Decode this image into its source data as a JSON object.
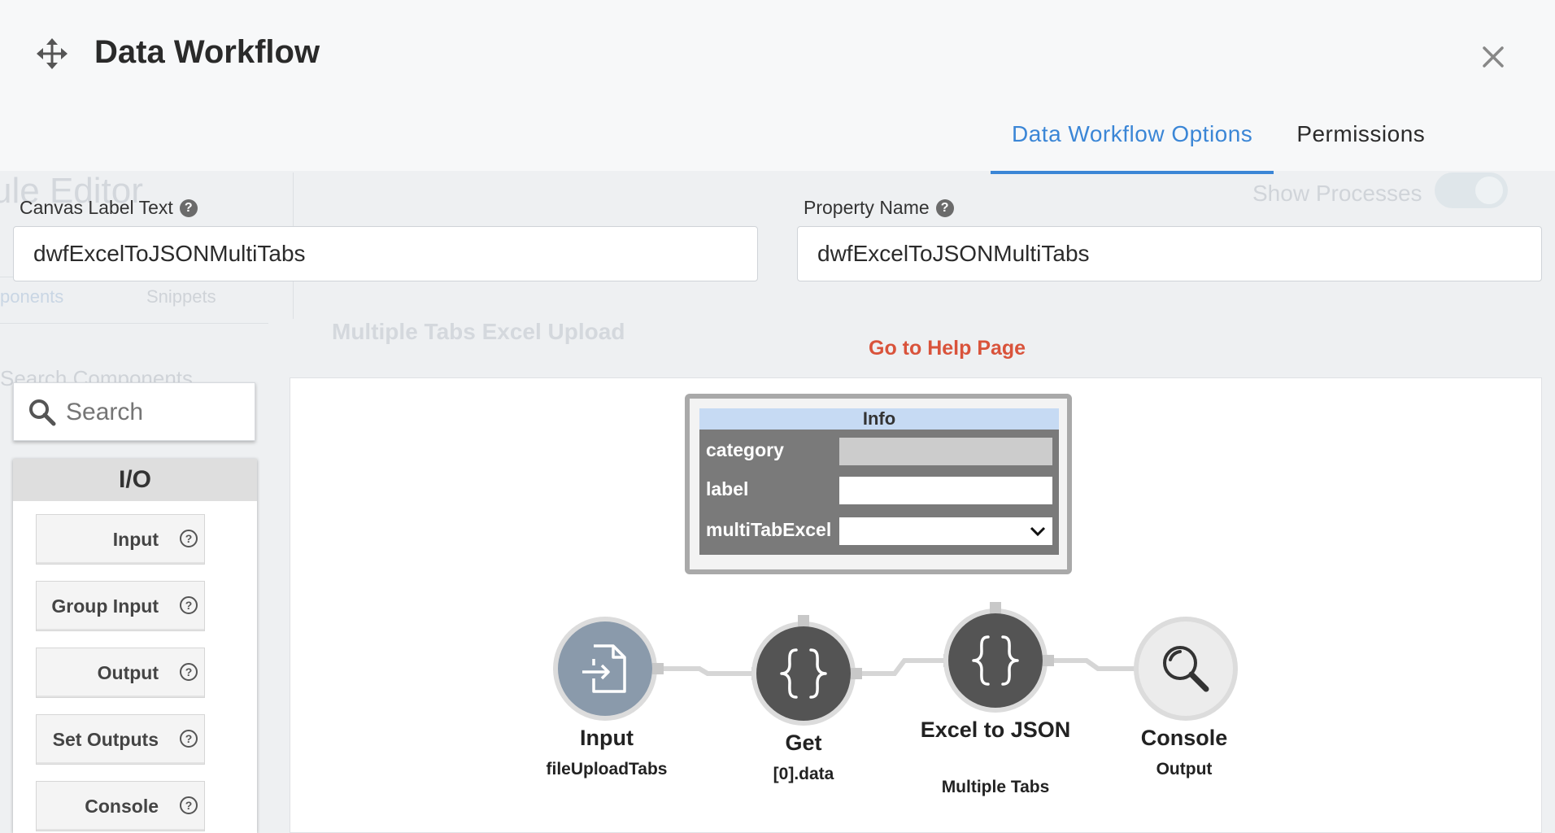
{
  "header": {
    "title": "Data Workflow",
    "tabs": [
      {
        "label": "Data Workflow Options",
        "active": true
      },
      {
        "label": "Permissions",
        "active": false
      }
    ]
  },
  "background": {
    "editor_title": "ule Editor",
    "show_processes": "Show Processes",
    "tab_components": "ponents",
    "tab_snippets": "Snippets",
    "page_heading": "Multiple Tabs Excel Upload",
    "search_components": "Search Components"
  },
  "fields": {
    "canvas_label": {
      "label": "Canvas Label Text",
      "value": "dwfExcelToJSONMultiTabs"
    },
    "property_name": {
      "label": "Property Name",
      "value": "dwfExcelToJSONMultiTabs"
    }
  },
  "help_link": "Go to Help Page",
  "palette": {
    "search_placeholder": "Search",
    "section": "I/O",
    "items": [
      "Input",
      "Group Input",
      "Output",
      "Set Outputs",
      "Console"
    ]
  },
  "info": {
    "title": "Info",
    "rows": [
      {
        "key": "category",
        "type": "readonly"
      },
      {
        "key": "label",
        "type": "text"
      },
      {
        "key": "multiTabExcel",
        "type": "select"
      }
    ]
  },
  "nodes": [
    {
      "title": "Input",
      "subtitle": "fileUploadTabs",
      "icon": "file-import-icon"
    },
    {
      "title": "Get",
      "subtitle": "[0].data",
      "icon": "braces-icon"
    },
    {
      "title": "Excel to JSON",
      "subtitle": "Multiple Tabs",
      "icon": "braces-icon"
    },
    {
      "title": "Console",
      "subtitle": "Output",
      "icon": "magnifier-icon"
    }
  ],
  "colors": {
    "accent": "#3b86d6",
    "help_link": "#d9533b",
    "info_header": "#c6daf3"
  }
}
